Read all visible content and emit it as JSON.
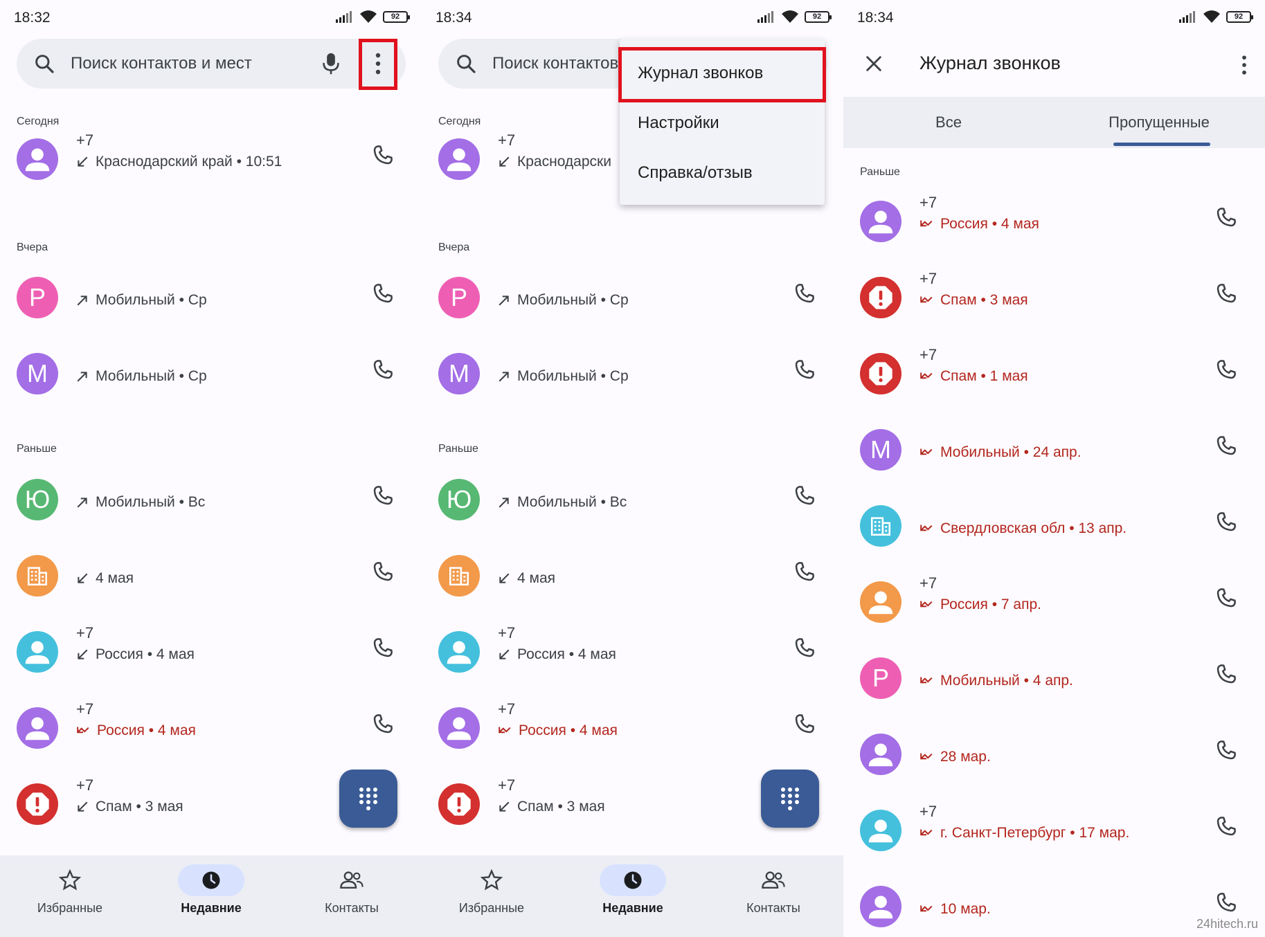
{
  "status": {
    "time1": "18:32",
    "time2": "18:34",
    "time3": "18:34",
    "battery": "92"
  },
  "search": {
    "placeholder": "Поиск контактов и мест",
    "placeholder_truncated": "Поиск контактов"
  },
  "colors": {
    "purple": "#a36ee6",
    "pink": "#ee5fb4",
    "green": "#57b873",
    "orange": "#f2994a",
    "cyan": "#44c0dd",
    "red": "#d3302f",
    "missed": "#b3261e",
    "fab": "#3a5b96"
  },
  "sections": {
    "today": "Сегодня",
    "yesterday": "Вчера",
    "earlier": "Раньше"
  },
  "recents": [
    {
      "avatar": "person",
      "color": "#a36ee6",
      "line1": "+7",
      "detail": "Краснодарский край • 10:51",
      "detail_truncated": "Краснодарски",
      "direction": "incoming",
      "missed": false
    },
    {
      "avatar": "Р",
      "color": "#ee5fb4",
      "line1": "",
      "detail": "Мобильный • Ср",
      "direction": "outgoing",
      "missed": false
    },
    {
      "avatar": "М",
      "color": "#a36ee6",
      "line1": "",
      "detail": "Мобильный • Ср",
      "direction": "outgoing",
      "missed": false
    },
    {
      "avatar": "Ю",
      "color": "#57b873",
      "line1": "",
      "detail": "Мобильный • Вс",
      "direction": "outgoing",
      "missed": false
    },
    {
      "avatar": "building",
      "color": "#f2994a",
      "line1": "",
      "detail": "4 мая",
      "direction": "incoming",
      "missed": false
    },
    {
      "avatar": "person",
      "color": "#44c0dd",
      "line1": "+7",
      "detail": "Россия • 4 мая",
      "direction": "incoming",
      "missed": false
    },
    {
      "avatar": "person",
      "color": "#a36ee6",
      "line1": "+7",
      "detail": "Россия • 4 мая",
      "direction": "missed",
      "missed": true
    },
    {
      "avatar": "spam",
      "color": "#d3302f",
      "line1": "+7",
      "detail": "Спам • 3 мая",
      "direction": "incoming",
      "missed": false
    }
  ],
  "nav": {
    "favorites": "Избранные",
    "recents": "Недавние",
    "contacts": "Контакты"
  },
  "menu": {
    "item1": "Журнал звонков",
    "item2": "Настройки",
    "item3": "Справка/отзыв"
  },
  "calllog": {
    "title": "Журнал звонков",
    "tab_all": "Все",
    "tab_missed": "Пропущенные",
    "section": "Раньше",
    "items": [
      {
        "avatar": "person",
        "color": "#a36ee6",
        "line1": "+7",
        "detail": "Россия • 4 мая"
      },
      {
        "avatar": "spam",
        "color": "#d3302f",
        "line1": "+7",
        "detail": "Спам • 3 мая"
      },
      {
        "avatar": "spam",
        "color": "#d3302f",
        "line1": "+7",
        "detail": "Спам • 1 мая"
      },
      {
        "avatar": "М",
        "color": "#a36ee6",
        "line1": "",
        "detail": "Мобильный • 24 апр."
      },
      {
        "avatar": "building",
        "color": "#44c0dd",
        "line1": "",
        "detail": "Свердловская обл • 13 апр."
      },
      {
        "avatar": "person",
        "color": "#f2994a",
        "line1": "+7",
        "detail": "Россия • 7 апр."
      },
      {
        "avatar": "Р",
        "color": "#ee5fb4",
        "line1": "",
        "detail": "Мобильный • 4 апр."
      },
      {
        "avatar": "person",
        "color": "#a36ee6",
        "line1": "",
        "detail": "28 мар."
      },
      {
        "avatar": "person",
        "color": "#44c0dd",
        "line1": "+7",
        "detail": "г. Санкт-Петербург • 17 мар."
      },
      {
        "avatar": "person",
        "color": "#a36ee6",
        "line1": "",
        "detail": "10 мар."
      }
    ]
  },
  "watermark": "24hitech.ru"
}
